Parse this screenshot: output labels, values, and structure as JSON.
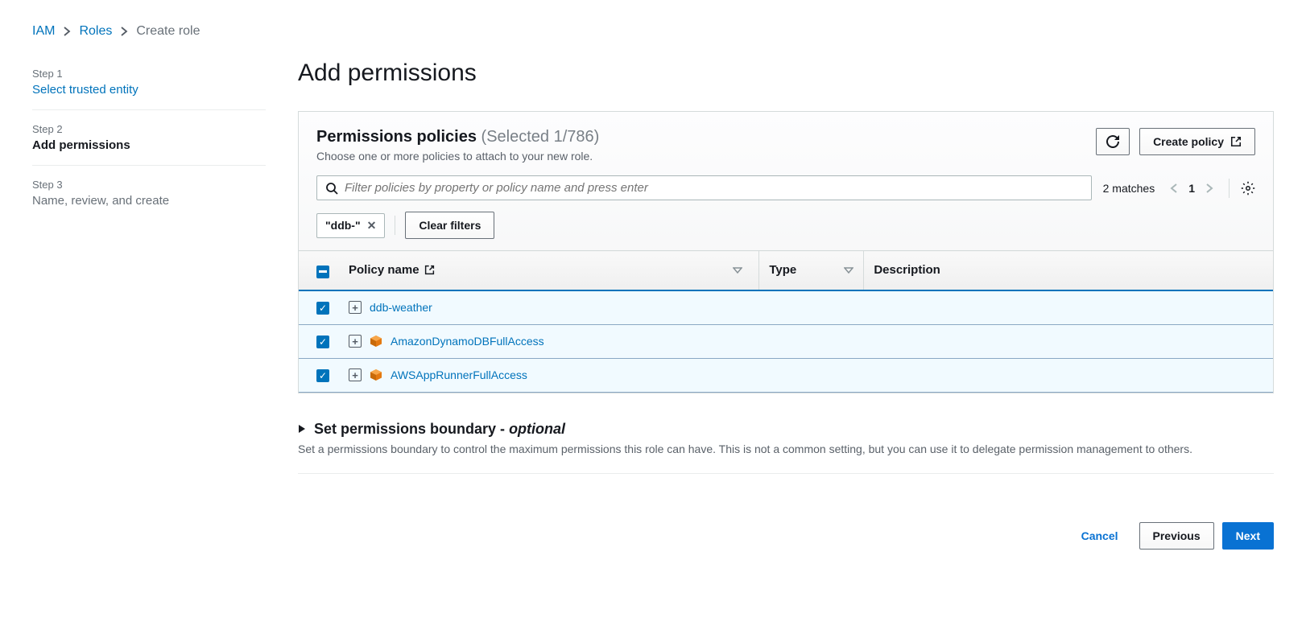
{
  "breadcrumb": {
    "iam": "IAM",
    "roles": "Roles",
    "current": "Create role"
  },
  "steps": {
    "s1_num": "Step 1",
    "s1_title": "Select trusted entity",
    "s2_num": "Step 2",
    "s2_title": "Add permissions",
    "s3_num": "Step 3",
    "s3_title": "Name, review, and create"
  },
  "page_title": "Add permissions",
  "panel": {
    "title": "Permissions policies",
    "selected_count": "(Selected 1/786)",
    "desc": "Choose one or more policies to attach to your new role.",
    "create_policy": "Create policy",
    "search_placeholder": "Filter policies by property or policy name and press enter",
    "matches": "2 matches",
    "page_num": "1",
    "filter_token": "\"ddb-\"",
    "clear_filters": "Clear filters"
  },
  "columns": {
    "policy_name": "Policy name",
    "type": "Type",
    "description": "Description"
  },
  "rows": [
    {
      "name": "ddb-weather",
      "managed": false
    },
    {
      "name": "AmazonDynamoDBFullAccess",
      "managed": true
    },
    {
      "name": "AWSAppRunnerFullAccess",
      "managed": true
    }
  ],
  "boundary": {
    "title_prefix": "Set permissions boundary - ",
    "optional": "optional",
    "desc": "Set a permissions boundary to control the maximum permissions this role can have. This is not a common setting, but you can use it to delegate permission management to others."
  },
  "footer": {
    "cancel": "Cancel",
    "previous": "Previous",
    "next": "Next"
  }
}
